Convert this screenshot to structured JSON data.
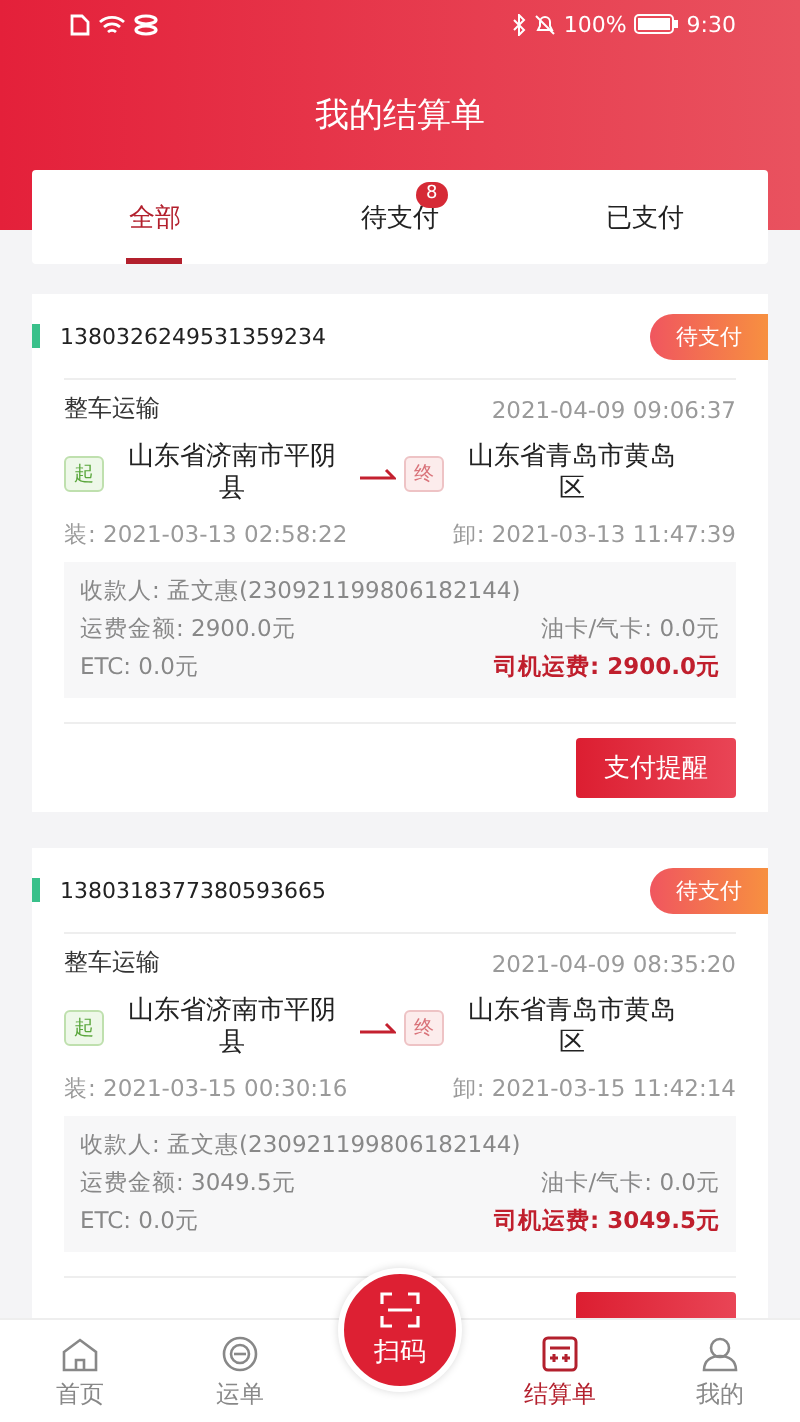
{
  "status_bar": {
    "battery": "100%",
    "time": "9:30"
  },
  "title": "我的结算单",
  "tabs": [
    {
      "label": "全部",
      "selected": true
    },
    {
      "label": "待支付",
      "selected": false,
      "badge": "8"
    },
    {
      "label": "已支付",
      "selected": false
    }
  ],
  "orders": [
    {
      "order_no": "1380326249531359234",
      "status": "待支付",
      "type": "整车运输",
      "created": "2021-04-09 09:06:37",
      "from_tag": "起",
      "from": "山东省济南市平阴县",
      "to_tag": "终",
      "to": "山东省青岛市黄岛区",
      "load": "装: 2021-03-13 02:58:22",
      "unload": "卸: 2021-03-13 11:47:39",
      "payee": "收款人: 孟文惠(230921199806182144)",
      "freight": "运费金额: 2900.0元",
      "fuel": "油卡/气卡: 0.0元",
      "etc": "ETC: 0.0元",
      "driver_fee": "司机运费: 2900.0元",
      "button": {
        "label": "支付提醒"
      }
    },
    {
      "order_no": "1380318377380593665",
      "status": "待支付",
      "type": "整车运输",
      "created": "2021-04-09 08:35:20",
      "from_tag": "起",
      "from": "山东省济南市平阴县",
      "to_tag": "终",
      "to": "山东省青岛市黄岛区",
      "load": "装: 2021-03-15 00:30:16",
      "unload": "卸: 2021-03-15 11:42:14",
      "payee": "收款人: 孟文惠(230921199806182144)",
      "freight": "运费金额: 3049.5元",
      "fuel": "油卡/气卡: 0.0元",
      "etc": "ETC: 0.0元",
      "driver_fee": "司机运费: 3049.5元",
      "button_cut": true
    }
  ],
  "scan": {
    "label": "扫码"
  },
  "nav": [
    {
      "label": "首页",
      "kind": "home",
      "selected": false
    },
    {
      "label": "运单",
      "kind": "waybill",
      "selected": false
    },
    {
      "label": "结算单",
      "kind": "bill",
      "selected": true
    },
    {
      "label": "我的",
      "kind": "user",
      "selected": false
    }
  ]
}
